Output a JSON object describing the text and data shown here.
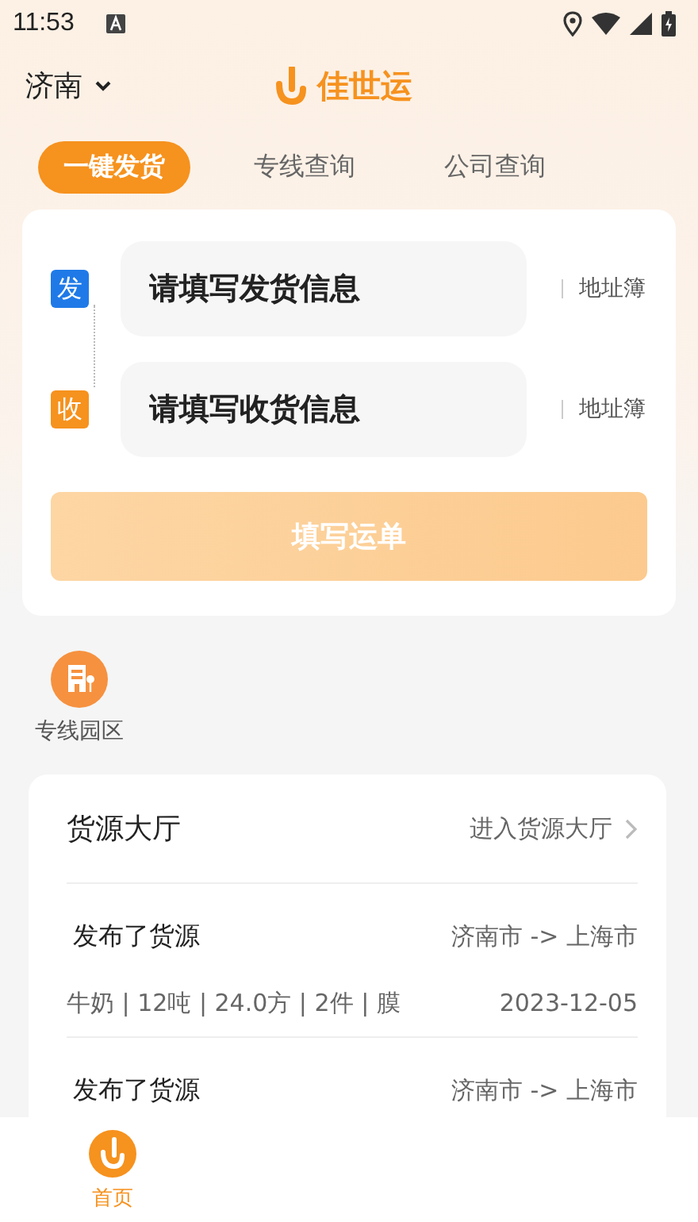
{
  "status_bar": {
    "time": "11:53"
  },
  "header": {
    "city": "济南",
    "app_name": "佳世运"
  },
  "tabs": [
    {
      "label": "一键发货",
      "selected": true
    },
    {
      "label": "专线查询",
      "selected": false
    },
    {
      "label": "公司查询",
      "selected": false
    }
  ],
  "shipping_form": {
    "fields": [
      {
        "badge": "发",
        "kind": "sender",
        "placeholder": "请填写发货信息",
        "link": "地址簿"
      },
      {
        "badge": "收",
        "kind": "receiver",
        "placeholder": "请填写收货信息",
        "link": "地址簿"
      }
    ],
    "submit": {
      "label": "填写运单",
      "disabled": true
    }
  },
  "shortcuts": [
    {
      "label": "专线园区"
    }
  ],
  "cargo_hall": {
    "title": "货源大厅",
    "more": "进入货源大厅",
    "items": [
      {
        "title": "发布了货源",
        "route": "济南市 -> 上海市",
        "details": "牛奶 | 12吨 | 24.0方 | 2件 | 膜",
        "date": "2023-12-05"
      },
      {
        "title": "发布了货源",
        "route": "济南市 -> 上海市"
      }
    ]
  },
  "bottom_nav": [
    {
      "label": "首页",
      "selected": true
    }
  ]
}
